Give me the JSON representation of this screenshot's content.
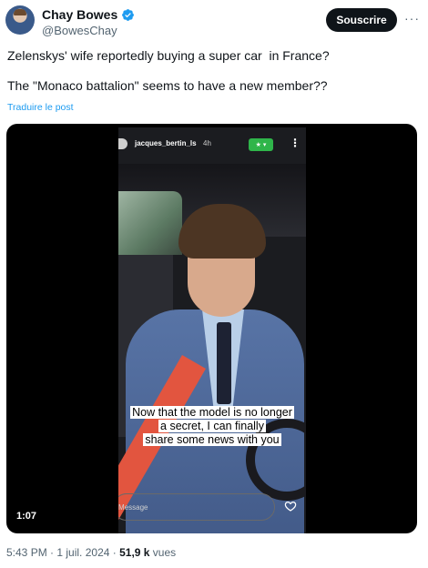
{
  "author": {
    "name": "Chay Bowes",
    "handle": "@BowesChay",
    "verified_icon": "verified-badge-icon",
    "accent_color": "#1d9bf0"
  },
  "actions": {
    "subscribe_label": "Souscrire",
    "more_label": "···"
  },
  "tweet": {
    "line1": "Zelenskys' wife reportedly buying a super car  in France?",
    "line2": "The \"Monaco battalion\" seems to have a new member??",
    "translate_label": "Traduire le post"
  },
  "video": {
    "duration": "1:07",
    "story": {
      "username": "jacques_bertin_ls",
      "time": "4h",
      "more_label": "⋮",
      "badge_icons": [
        "star-icon",
        "chevron-down-icon"
      ],
      "caption_lines": [
        "Now that the model is no longer",
        "a secret, I can finally",
        "share some news with you"
      ],
      "message_placeholder": "Message",
      "heart_icon": "heart-icon"
    }
  },
  "meta": {
    "time": "5:43 PM",
    "sep1": " · ",
    "date": "1 juil. 2024",
    "sep2": " · ",
    "views_count": "51,9 k",
    "views_label": " vues"
  }
}
